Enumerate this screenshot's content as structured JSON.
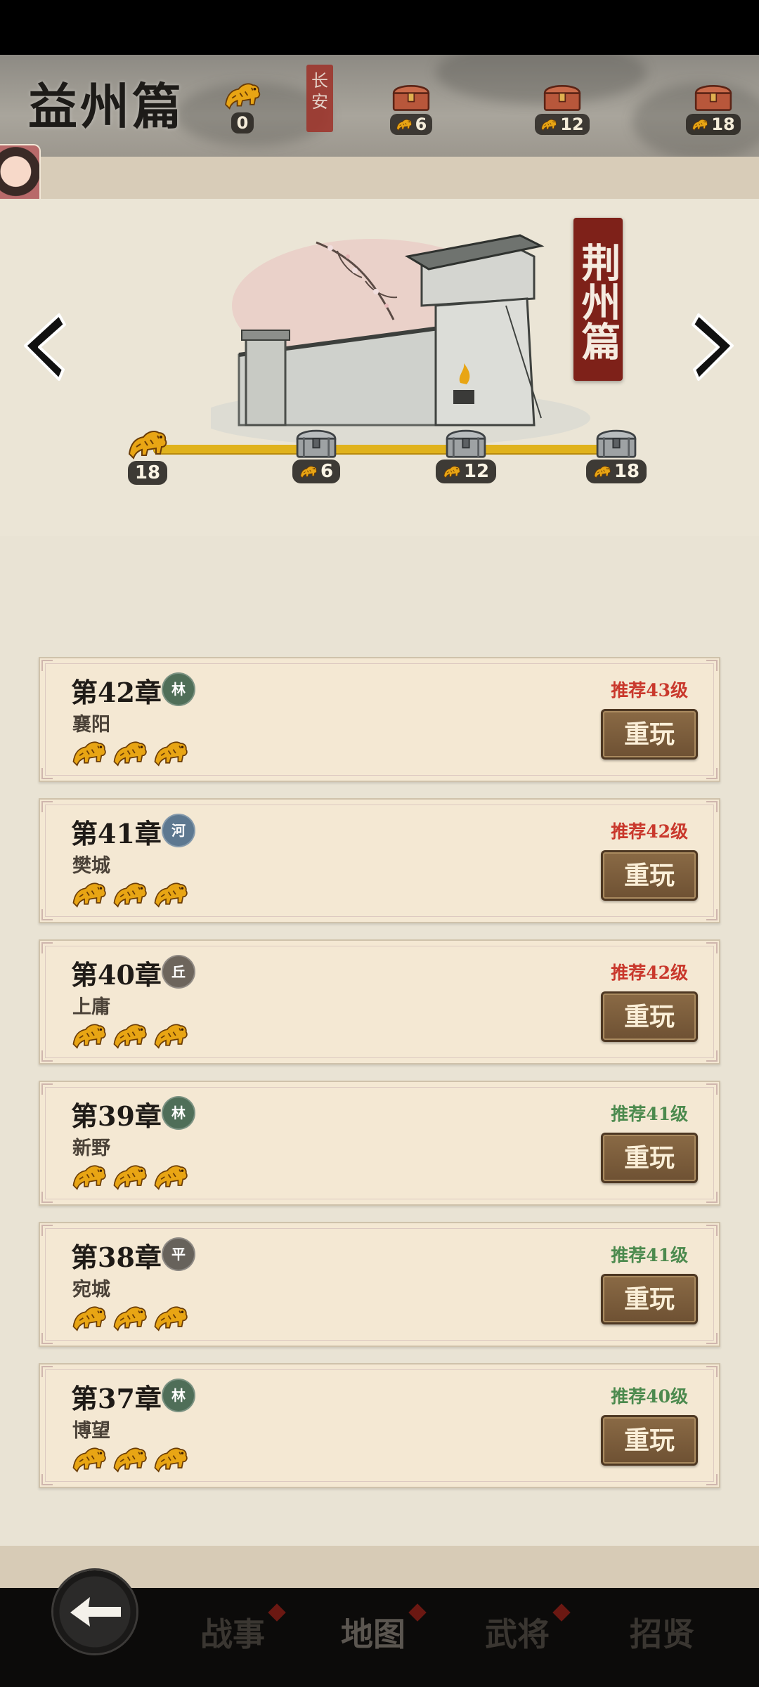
{
  "header": {
    "title": "益州篇",
    "seal_text": "长安",
    "current_stars": "0",
    "milestones": [
      "6",
      "12",
      "18"
    ]
  },
  "banner": {
    "title": "荆州篇",
    "stars_collected": "18",
    "milestones": [
      "6",
      "12",
      "18"
    ]
  },
  "chapters": [
    {
      "title": "第42章",
      "terrain": "林",
      "terrain_color": "#4f6e58",
      "place": "襄阳",
      "recommend": "推荐43级",
      "recommend_color": "#c9382c",
      "button": "重玩",
      "stars": 3
    },
    {
      "title": "第41章",
      "terrain": "河",
      "terrain_color": "#5d7890",
      "place": "樊城",
      "recommend": "推荐42级",
      "recommend_color": "#c9382c",
      "button": "重玩",
      "stars": 3
    },
    {
      "title": "第40章",
      "terrain": "丘",
      "terrain_color": "#6d655c",
      "place": "上庸",
      "recommend": "推荐42级",
      "recommend_color": "#c9382c",
      "button": "重玩",
      "stars": 3
    },
    {
      "title": "第39章",
      "terrain": "林",
      "terrain_color": "#4f6e58",
      "place": "新野",
      "recommend": "推荐41级",
      "recommend_color": "#4c8a4e",
      "button": "重玩",
      "stars": 3
    },
    {
      "title": "第38章",
      "terrain": "平",
      "terrain_color": "#67625b",
      "place": "宛城",
      "recommend": "推荐41级",
      "recommend_color": "#4c8a4e",
      "button": "重玩",
      "stars": 3
    },
    {
      "title": "第37章",
      "terrain": "林",
      "terrain_color": "#4f6e58",
      "place": "博望",
      "recommend": "推荐40级",
      "recommend_color": "#4c8a4e",
      "button": "重玩",
      "stars": 3
    }
  ],
  "nav": {
    "tabs": [
      "战事",
      "地图",
      "武将",
      "招贤"
    ],
    "active": "地图"
  },
  "colors": {
    "accent_gold": "#e0b21c",
    "seal_red": "#7e2119",
    "paper": "#f4e8d3"
  }
}
